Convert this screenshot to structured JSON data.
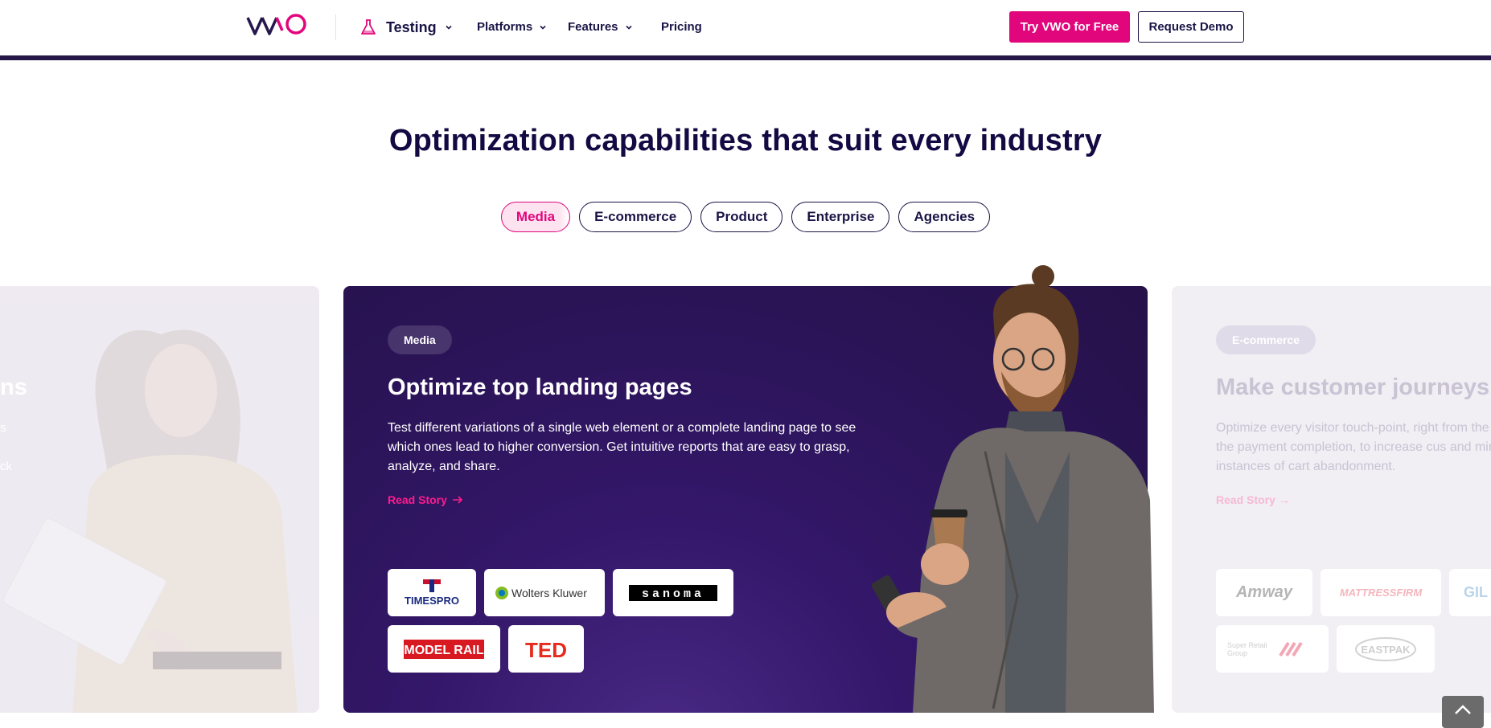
{
  "nav": {
    "product_label": "Testing",
    "items": [
      "Platforms",
      "Features",
      "Pricing"
    ],
    "cta_primary": "Try VWO for Free",
    "cta_secondary": "Request Demo"
  },
  "headline": "Optimization capabilities that suit every industry",
  "tabs": [
    "Media",
    "E-commerce",
    "Product",
    "Enterprise",
    "Agencies"
  ],
  "active_tab": "Media",
  "card": {
    "tag": "Media",
    "title": "Optimize top landing pages",
    "description": "Test different variations of a single web element or a complete landing page to see which ones lead to higher conversion. Get intuitive reports that are easy to grasp, analyze, and share.",
    "link": "Read Story",
    "logos": [
      "TIMESPRO",
      "Wolters Kluwer",
      "sanoma",
      "MODEL RAIL",
      "TED"
    ]
  },
  "left_card": {
    "title_fragment": "ns",
    "line1": "s",
    "line2": "ck"
  },
  "right_card": {
    "tag": "E-commerce",
    "title": "Make customer journeys",
    "description": "Optimize every visitor touch-point, right from the page till the payment completion, to increase cus and minimize instances of cart abandonment.",
    "link": "Read Story",
    "logos": [
      "Amway",
      "MATTRESSFIRM",
      "GIL",
      "Super Retail Group",
      "EASTPAK"
    ]
  },
  "colors": {
    "brand_pink": "#e2067c",
    "navy": "#1a1446",
    "card_purple": "#2a1456"
  }
}
